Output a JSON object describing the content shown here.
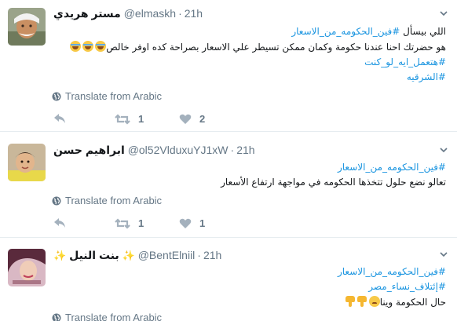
{
  "tweets": [
    {
      "name": "مستر هريدي",
      "handle": "@elmaskh",
      "time": "21h",
      "lines": [
        {
          "parts": [
            {
              "t": "اللي بيسأل ",
              "h": false
            },
            {
              "t": "#فين_الحكومه_من_الاسعار",
              "h": true
            }
          ]
        },
        {
          "parts": [
            {
              "t": "هو حضرتك احنا عندنا حكومة وكمان ممكن تسيطر علي الاسعار بصراحة كده اوفر خالص",
              "h": false
            }
          ]
        },
        {
          "parts": [
            {
              "t": "#هتعمل_ايه_لو_كنت",
              "h": true
            }
          ]
        },
        {
          "parts": [
            {
              "t": "#الشرقيه",
              "h": true
            }
          ]
        }
      ],
      "translate": "Translate from Arabic",
      "retweets": "1",
      "likes": "2"
    },
    {
      "name": "ابراهيم حسن",
      "handle": "@ol52VlduxuYJ1xW",
      "time": "21h",
      "lines": [
        {
          "parts": [
            {
              "t": "#فين_الحكومه_من_الاسعار",
              "h": true
            }
          ]
        },
        {
          "parts": [
            {
              "t": "تعالو نضع حلول تتخذها الحكومه في مواجهة ارتفاع الأسعار",
              "h": false
            }
          ]
        }
      ],
      "translate": "Translate from Arabic",
      "retweets": "1",
      "likes": "1"
    },
    {
      "name": "بنت النيل",
      "handle": "@BentElniil",
      "time": "21h",
      "lines": [
        {
          "parts": [
            {
              "t": "#فين_الحكومه_من_الاسعار",
              "h": true
            }
          ]
        },
        {
          "parts": [
            {
              "t": "#إئتلاف_نساء_مصر",
              "h": true
            }
          ]
        },
        {
          "parts": [
            {
              "t": "حال الحكومة وينا",
              "h": false
            }
          ]
        }
      ],
      "translate": "Translate from Arabic"
    }
  ],
  "icons": {
    "globe": "globe-icon",
    "reply": "reply-icon",
    "retweet": "retweet-icon",
    "like": "heart-icon",
    "caret": "chevron-down-icon",
    "sparkle": "sparkles-icon"
  },
  "colors": {
    "hashtag": "#1b95e0",
    "meta": "#657786",
    "action": "#a4b1bd"
  }
}
